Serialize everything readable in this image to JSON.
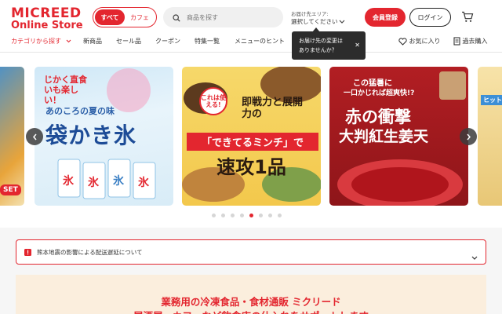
{
  "header": {
    "logo_line1": "MICREED",
    "logo_line2": "Online Store",
    "segment": [
      "すべて",
      "カフェ"
    ],
    "search_placeholder": "商品を探す",
    "area_label": "お届け先エリア:",
    "area_value": "選択してください",
    "register": "会員登録",
    "login": "ログイン"
  },
  "nav": {
    "items": [
      "カテゴリから探す",
      "新商品",
      "セール品",
      "クーポン",
      "特集一覧",
      "メニューのヒント"
    ],
    "favorites": "お気に入り",
    "history": "過去購入"
  },
  "tooltip": {
    "line1": "お届け先の変更は",
    "line2": "ありませんか？"
  },
  "banners": {
    "b0": "SET",
    "b1_top": "じかく直食いも楽しい！",
    "b1_sub": "あのころの夏の味",
    "b1_main": "袋かき氷",
    "b2_badge": "これは使える!",
    "b2_sub": "即戦力と展開力の",
    "b2_main1": "「できてるミンチ」で",
    "b2_main2": "速攻1品",
    "b3_sub1": "この猛暑に",
    "b3_sub2": "一口かじれば超爽快!?",
    "b3_main1": "赤の衝撃",
    "b3_main2": "大判紅生姜天",
    "b4": "ヒット"
  },
  "carousel": {
    "dot_count": 8,
    "active_index": 4
  },
  "notice": {
    "text": "熊本地震の影響による配送遅延について"
  },
  "promo": {
    "line1": "業務用の冷凍食品・食材通販 ミクリード",
    "line2": "居酒屋・カフェなど飲食店の仕入れをサポートします"
  },
  "colors": {
    "accent": "#e3262f"
  }
}
